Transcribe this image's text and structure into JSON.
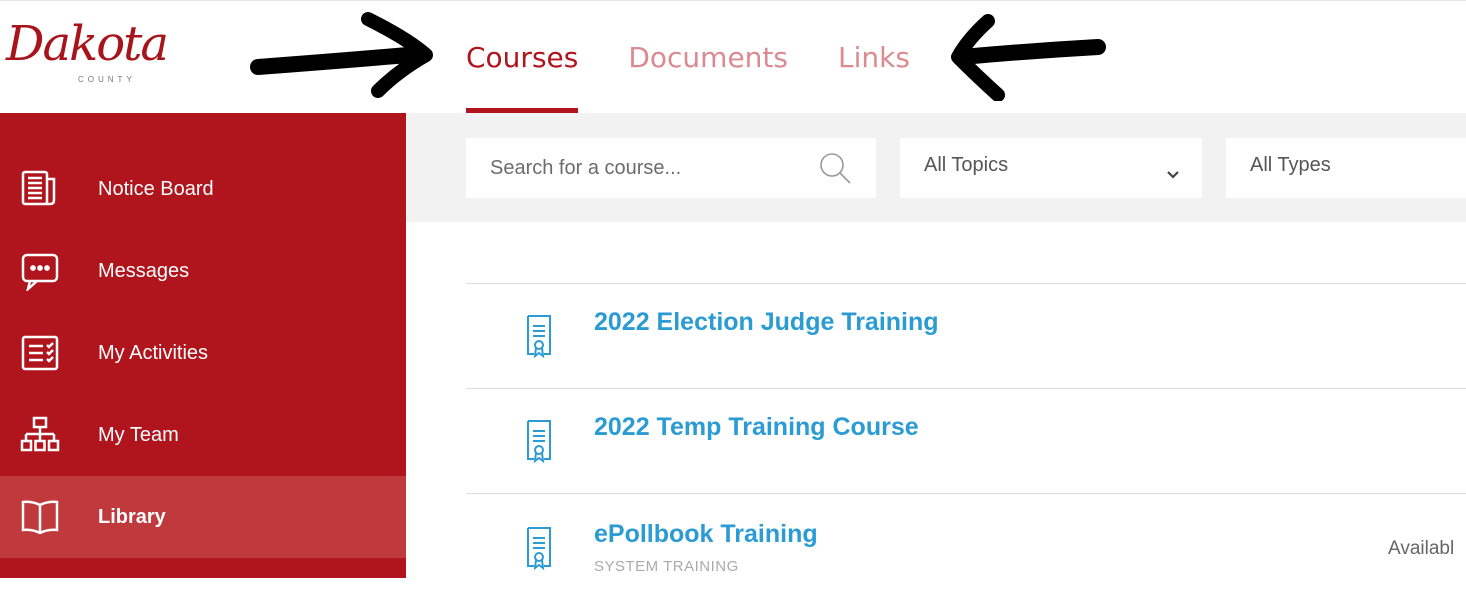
{
  "brand": {
    "name": "Dakota",
    "subtitle": "COUNTY",
    "color": "#b0141c"
  },
  "tabs": [
    {
      "label": "Courses",
      "active": true
    },
    {
      "label": "Documents",
      "active": false
    },
    {
      "label": "Links",
      "active": false
    }
  ],
  "annotations": [
    {
      "type": "arrow",
      "direction": "right",
      "icon": "arrow-right-icon"
    },
    {
      "type": "arrow",
      "direction": "left",
      "icon": "arrow-left-icon"
    }
  ],
  "sidebar": {
    "items": [
      {
        "label": "Notice Board",
        "icon": "newspaper-icon",
        "active": false
      },
      {
        "label": "Messages",
        "icon": "chat-bubble-icon",
        "active": false
      },
      {
        "label": "My Activities",
        "icon": "checklist-icon",
        "active": false
      },
      {
        "label": "My Team",
        "icon": "org-chart-icon",
        "active": false
      },
      {
        "label": "Library",
        "icon": "book-icon",
        "active": true
      }
    ]
  },
  "filters": {
    "search_placeholder": "Search for a course...",
    "topics_value": "All Topics",
    "types_value": "All Types"
  },
  "courses": [
    {
      "title": "2022 Election Judge Training",
      "subtitle": "",
      "status": ""
    },
    {
      "title": "2022 Temp Training Course",
      "subtitle": "",
      "status": ""
    },
    {
      "title": "ePollbook Training",
      "subtitle": "SYSTEM TRAINING",
      "status": "Availabl"
    }
  ]
}
